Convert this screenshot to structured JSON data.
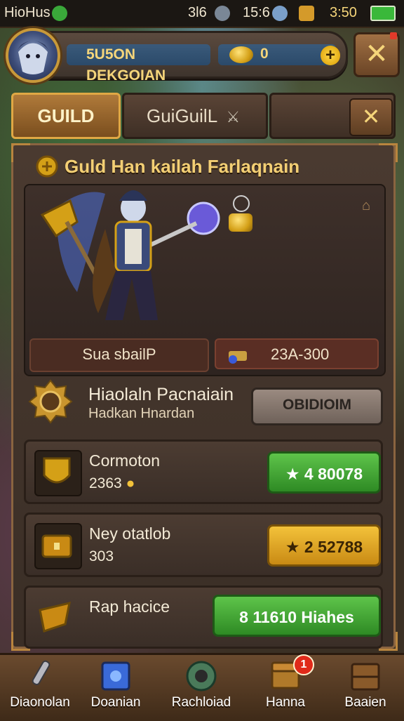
{
  "status": {
    "carrier": "HioHus",
    "signal": "3l6",
    "time": "15:6",
    "battery_time": "3:50"
  },
  "header": {
    "player_name": "5U5ON DEKGOIAN",
    "gold": "0",
    "plus_label": "+",
    "close_label": "✕"
  },
  "tabs": [
    {
      "label": "GUILD"
    },
    {
      "label": "GuiGuilL"
    },
    {
      "label": ""
    }
  ],
  "tab_close_label": "✕",
  "panel": {
    "title": "Guld Han kailah Farlaqnain",
    "hero_left_label": "Sua sbailP",
    "hero_right_label": "23A-300",
    "section_title": "Hiaolaln Pacnaiain",
    "section_subtitle": "Hadkan Hnardan",
    "section_button": "OBIDIOIM"
  },
  "rows": [
    {
      "name": "Cormoton",
      "value": "2363",
      "button": "★ 4 80078",
      "style": "green"
    },
    {
      "name": "Ney otatlob",
      "value": "303",
      "button": "★ 2 52788",
      "style": "gold"
    },
    {
      "name": "Rap hacice",
      "value": "",
      "button": "8 11610 Hiahes",
      "style": "green"
    }
  ],
  "nav": [
    {
      "label": "Diaonolan",
      "icon": "sword-icon"
    },
    {
      "label": "Doanian",
      "icon": "spellbook-icon"
    },
    {
      "label": "Rachloiad",
      "icon": "cannon-icon"
    },
    {
      "label": "Hanna",
      "icon": "chest-icon",
      "badge": "1"
    },
    {
      "label": "Baaien",
      "icon": "crate-icon"
    }
  ],
  "colors": {
    "accent_gold": "#f3cf74",
    "green_button": "#3ea632",
    "gold_button": "#e0a828",
    "panel_border": "#8a6440"
  }
}
